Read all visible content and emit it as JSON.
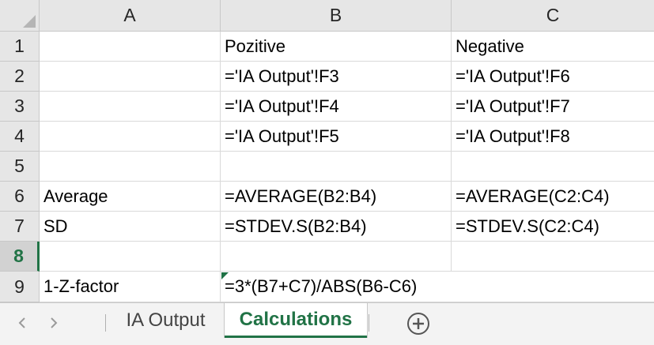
{
  "columns": [
    "A",
    "B",
    "C"
  ],
  "rows": [
    "1",
    "2",
    "3",
    "4",
    "5",
    "6",
    "7",
    "8",
    "9"
  ],
  "active_row": "8",
  "cells": {
    "A1": "",
    "B1": "Pozitive",
    "C1": "Negative",
    "A2": "",
    "B2": "='IA Output'!F3",
    "C2": "='IA Output'!F6",
    "A3": "",
    "B3": "='IA Output'!F4",
    "C3": "='IA Output'!F7",
    "A4": "",
    "B4": "='IA Output'!F5",
    "C4": "='IA Output'!F8",
    "A5": "",
    "B5": "",
    "C5": "",
    "A6": "Average",
    "B6": "=AVERAGE(B2:B4)",
    "C6": "=AVERAGE(C2:C4)",
    "A7": "SD",
    "B7": "=STDEV.S(B2:B4)",
    "C7": "=STDEV.S(C2:C4)",
    "A8": "",
    "B8": "",
    "C8": "",
    "A9": "1-Z-factor",
    "B9": "=3*(B7+C7)/ABS(B6-C6)",
    "C9": ""
  },
  "sheet_tabs": [
    {
      "label": "IA Output",
      "active": false
    },
    {
      "label": "Calculations",
      "active": true
    }
  ],
  "icons": {
    "prev": "chevron-left-icon",
    "next": "chevron-right-icon",
    "add": "plus-circle-icon"
  },
  "colors": {
    "accent": "#217346",
    "header_bg": "#e6e6e6",
    "tabbar_bg": "#f3f3f3"
  }
}
